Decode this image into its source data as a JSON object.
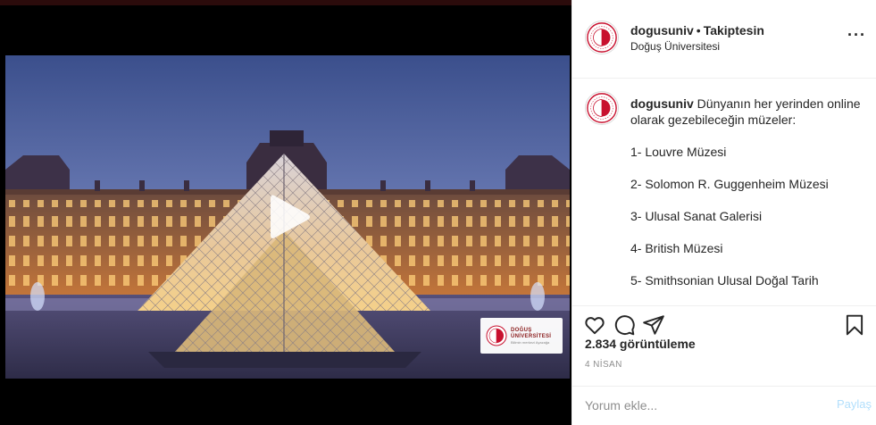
{
  "post": {
    "username": "dogusuniv",
    "separator": "•",
    "follow_status": "Takiptesin",
    "location": "Doğuş Üniversitesi",
    "more_icon": "more-horizontal-icon",
    "more_glyph": "···"
  },
  "caption": {
    "username": "dogusuniv",
    "text": "Dünyanın her yerinden online olarak gezebileceğin müzeler:",
    "items": [
      "1- Louvre Müzesi",
      "2- Solomon R. Guggenheim Müzesi",
      "3- Ulusal Sanat Galerisi",
      "4- British Müzesi",
      "5- Smithsonian Ulusal Doğal Tarih"
    ]
  },
  "video_overlay": {
    "logo_line1": "DOĞUŞ",
    "logo_line2": "ÜNİVERSİTESİ",
    "logo_line3": "Bilimin merkezi Ayazağa"
  },
  "actions": {
    "icons": [
      "heart-icon",
      "comment-icon",
      "share-icon",
      "bookmark-icon"
    ],
    "views": "2.834 görüntüleme",
    "date": "4 NİSAN"
  },
  "comment": {
    "placeholder": "Yorum ekle...",
    "share_label": "Paylaş"
  },
  "colors": {
    "brand_red": "#c8102e",
    "link_disabled": "#b2dffc",
    "muted": "#8e8e8e",
    "border": "#efefef"
  }
}
